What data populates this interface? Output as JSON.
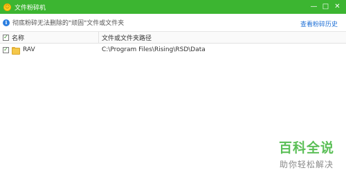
{
  "window": {
    "title": "文件粉碎机",
    "controls": {
      "minimize": "—",
      "maximize": "□",
      "close": "✕"
    }
  },
  "info_bar": {
    "icon": "info-icon",
    "text": "彻底粉碎无法删除的\"顽固\"文件或文件夹",
    "history_link": "查看粉碎历史"
  },
  "table": {
    "columns": [
      "名称",
      "文件或文件夹路径"
    ],
    "header_checked": true,
    "rows": [
      {
        "checked": true,
        "icon": "folder-icon",
        "name": "RAV",
        "path": "C:\\Program Files\\Rising\\RSD\\Data"
      }
    ]
  },
  "watermark": {
    "brand": "百科全说",
    "slogan": "助你轻松解决"
  },
  "colors": {
    "titlebar": "#3cb531",
    "link": "#1d6fd6",
    "watermark": "#5bbf57"
  }
}
